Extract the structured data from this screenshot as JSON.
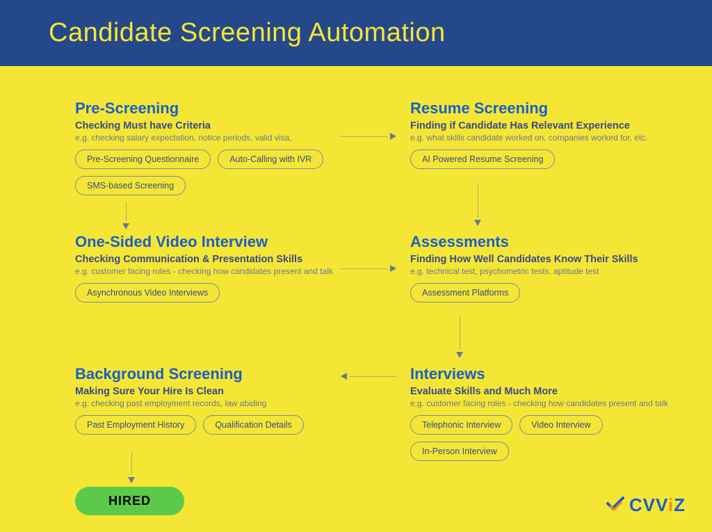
{
  "header": {
    "title": "Candidate Screening Automation"
  },
  "blocks": {
    "pre": {
      "title": "Pre-Screening",
      "subtitle": "Checking Must have Criteria",
      "example": "e.g. checking salary expectation, notice periods, valid visa,",
      "pills": [
        "Pre-Screening Questionnaire",
        "Auto-Calling with IVR",
        "SMS-based Screening"
      ]
    },
    "resume": {
      "title": "Resume Screening",
      "subtitle": "Finding if Candidate Has Relevant Experience",
      "example": "e.g. what skills candidate worked on, companies worked for, etc.",
      "pills": [
        "AI Powered Resume Screening"
      ]
    },
    "video": {
      "title": "One-Sided Video Interview",
      "subtitle": "Checking Communication & Presentation Skills",
      "example": "e.g. customer facing roles - checking how candidates present and talk",
      "pills": [
        "Asynchronous Video Interviews"
      ]
    },
    "assess": {
      "title": "Assessments",
      "subtitle": "Finding How Well Candidates Know Their Skills",
      "example": "e.g. technical test, psychometric tests, aptitude test",
      "pills": [
        "Assessment Platforms"
      ]
    },
    "bg": {
      "title": "Background Screening",
      "subtitle": "Making Sure Your Hire Is Clean",
      "example": "e.g. checking past employment records, law abiding",
      "pills": [
        "Past Employment History",
        "Qualification Details"
      ]
    },
    "interviews": {
      "title": "Interviews",
      "subtitle": "Evaluate Skills and Much More",
      "example": "e.g. customer facing roles - checking how candidates present and talk",
      "pills": [
        "Telephonic Interview",
        "Video Interview",
        "In-Person Interview"
      ]
    }
  },
  "hired_label": "HIRED",
  "logo": {
    "text": "CVV",
    "accent": "i",
    "tail": "Z"
  }
}
